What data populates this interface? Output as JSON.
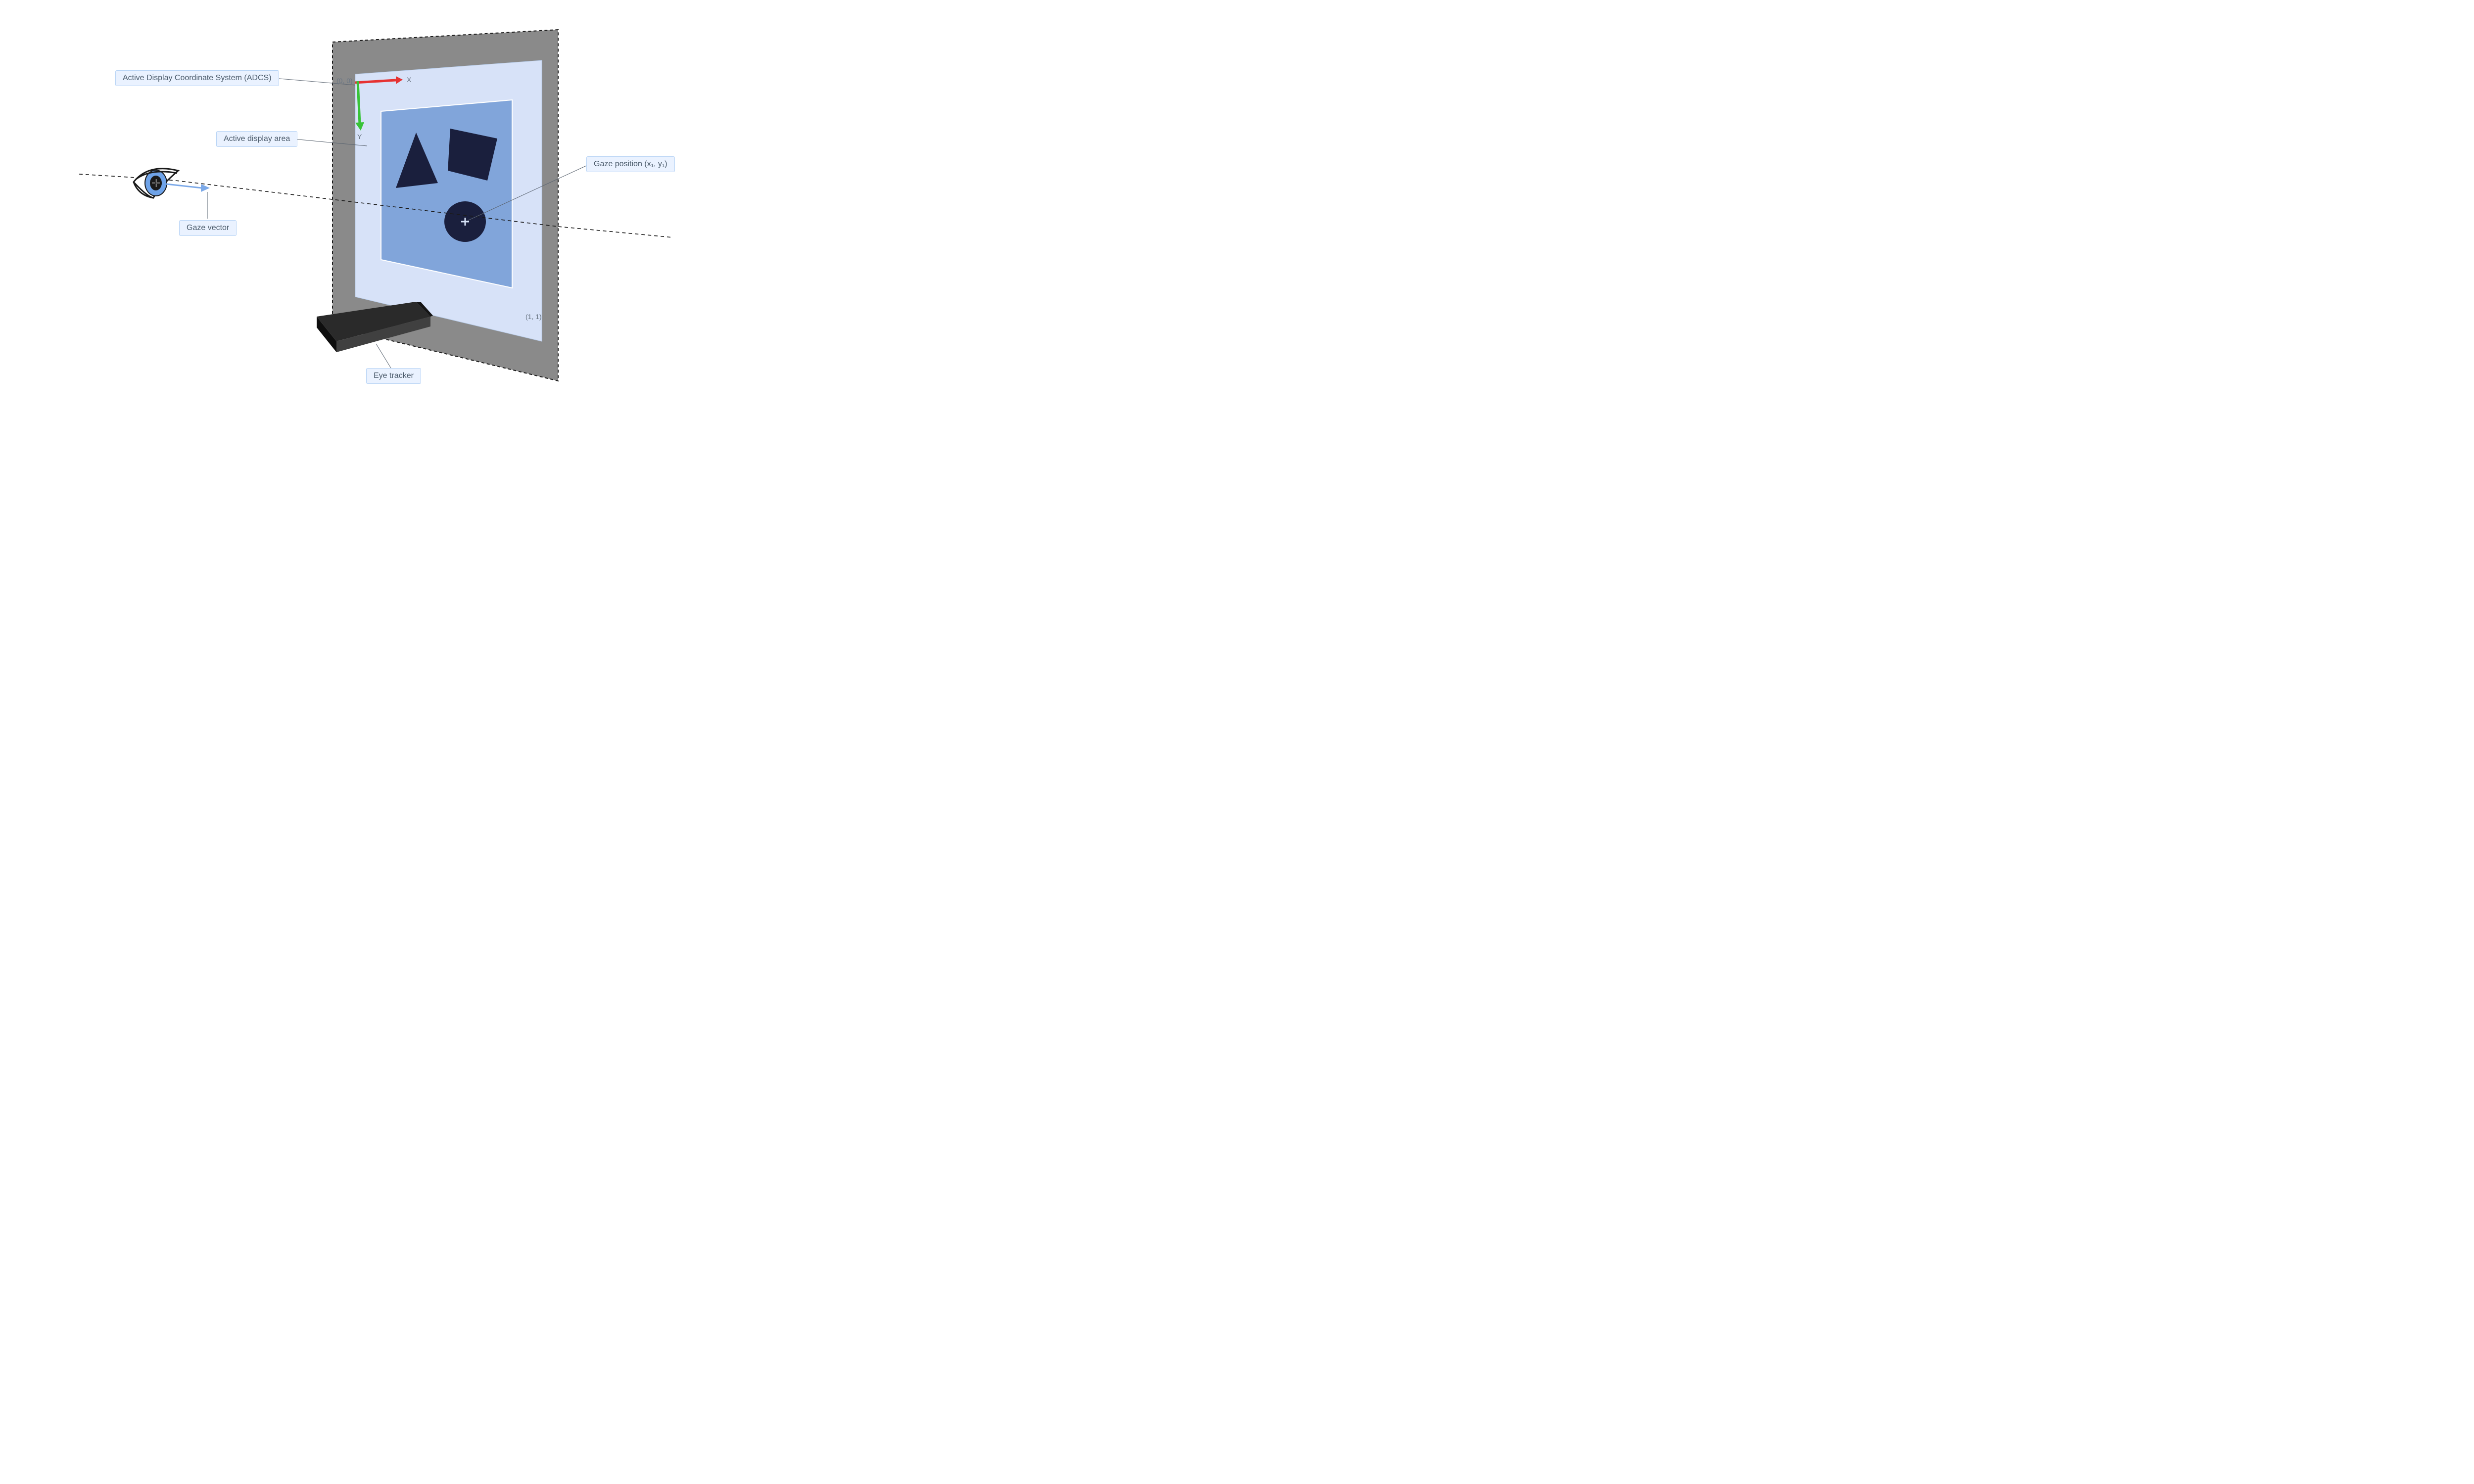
{
  "labels": {
    "adcs": "Active Display Coordinate System (ADCS)",
    "active_display_area": "Active display area",
    "gaze_vector": "Gaze vector",
    "eye_tracker": "Eye tracker",
    "gaze_position": "Gaze position (x₁, y₁)"
  },
  "coords": {
    "origin": "(0, 0)",
    "end": "(1, 1)",
    "x_axis": "X",
    "y_axis": "Y"
  },
  "colors": {
    "outer_frame": "#8a8a8a",
    "display_area": "#d7e2f8",
    "inner_content": "#81a5da",
    "shapes": "#1a1f3d",
    "x_axis": "#e63232",
    "y_axis": "#38c338",
    "gaze_arrow": "#7ca9e8",
    "dash": "#1a1a1a",
    "label_bg": "#eaf2ff",
    "label_border": "#b8d4f5"
  },
  "diagram": {
    "description": "Perspective eye-tracking diagram showing an eye emitting a gaze vector towards a display. The display has an Active Display Coordinate System with origin (0,0) at top-left and (1,1) at bottom-right. The gaze lands at a gaze position (x1, y1) on a dark circle. A separate eye tracker device sits below the display.",
    "elements": [
      "eye with pupil crosshair",
      "gaze vector dashed line with light blue arrow",
      "perspective monitor frame (dashed outline)",
      "active display area (light blue)",
      "inner content rect (medium blue) with triangle, quadrilateral, circle shapes",
      "red X axis arrow, green Y axis arrow",
      "eye tracker bar device below monitor"
    ]
  }
}
